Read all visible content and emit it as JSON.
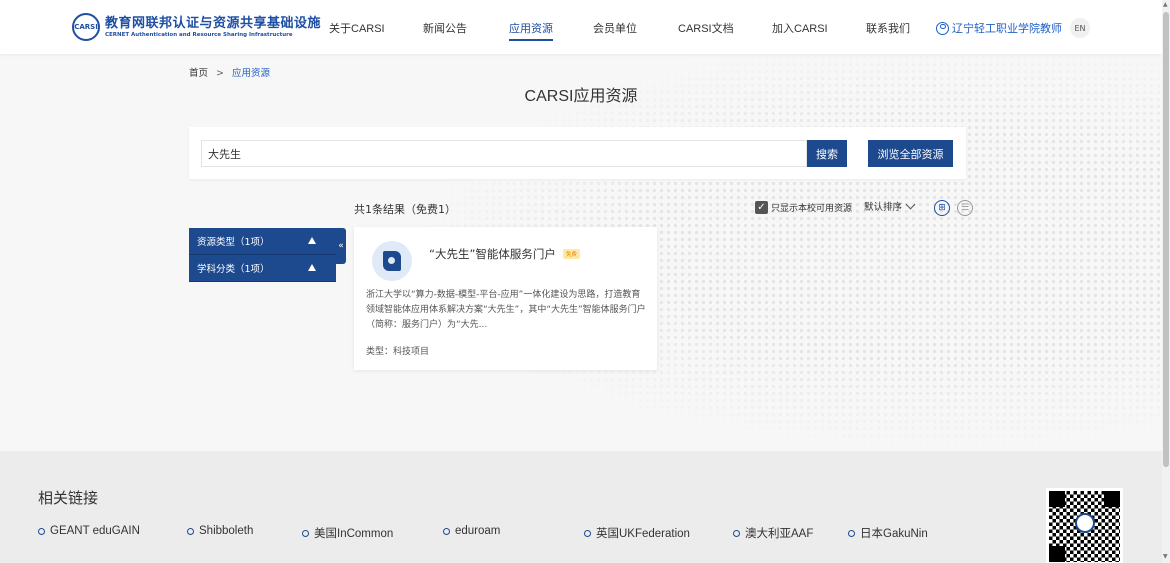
{
  "header": {
    "logo_mark": "CARSI",
    "logo_cn": "教育网联邦认证与资源共享基础设施",
    "logo_en": "CERNET Authentication and Resource Sharing Infrastructure",
    "nav": [
      {
        "label": "关于CARSI",
        "active": false
      },
      {
        "label": "新闻公告",
        "active": false
      },
      {
        "label": "应用资源",
        "active": true
      },
      {
        "label": "会员单位",
        "active": false
      },
      {
        "label": "CARSI文档",
        "active": false
      },
      {
        "label": "加入CARSI",
        "active": false
      },
      {
        "label": "联系我们",
        "active": false
      }
    ],
    "user": "辽宁轻工职业学院教师",
    "lang": "EN"
  },
  "breadcrumb": {
    "home": "首页",
    "sep": ">",
    "current": "应用资源"
  },
  "page_title": "CARSI应用资源",
  "search": {
    "value": "大先生",
    "search_label": "搜索",
    "browse_label": "浏览全部资源"
  },
  "results": {
    "count_text": "共1条结果（免费1）",
    "filter_label": "只显示本校可用资源",
    "filter_checked": true,
    "sort_label": "默认排序"
  },
  "sidebar": {
    "items": [
      {
        "label": "资源类型（1项）"
      },
      {
        "label": "学科分类（1项）"
      }
    ],
    "collapse": "«"
  },
  "card": {
    "title": "“大先生”智能体服务门户",
    "badge": "免费",
    "description": "浙江大学以“算力-数据-模型-平台-应用”一体化建设为思路，打造教育领域智能体应用体系解决方案“大先生”，其中“大先生”智能体服务门户（简称：服务门户）为“大先...",
    "type": "类型：科技项目"
  },
  "footer": {
    "title": "相关链接",
    "links": [
      "GEANT eduGAIN",
      "Shibboleth",
      "美国InCommon",
      "eduroam",
      "英国UKFederation",
      "澳大利亚AAF",
      "日本GakuNin"
    ]
  },
  "colors": {
    "primary": "#1d4a8f",
    "link": "#1e5fc7",
    "badge_bg": "#ffe9a8"
  }
}
